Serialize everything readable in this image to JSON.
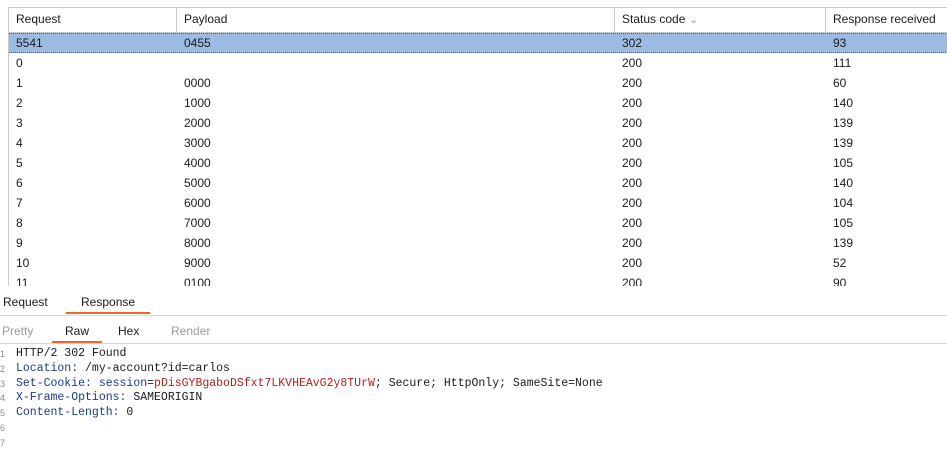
{
  "results_table": {
    "columns": [
      "Request",
      "Payload",
      "Status code",
      "Response received"
    ],
    "sorted_column_icon": "chevron-down-icon",
    "rows": [
      {
        "request": "5541",
        "payload": "0455",
        "status": "302",
        "response": "93",
        "selected": true
      },
      {
        "request": "0",
        "payload": "",
        "status": "200",
        "response": "111"
      },
      {
        "request": "1",
        "payload": "0000",
        "status": "200",
        "response": "60"
      },
      {
        "request": "2",
        "payload": "1000",
        "status": "200",
        "response": "140"
      },
      {
        "request": "3",
        "payload": "2000",
        "status": "200",
        "response": "139"
      },
      {
        "request": "4",
        "payload": "3000",
        "status": "200",
        "response": "139"
      },
      {
        "request": "5",
        "payload": "4000",
        "status": "200",
        "response": "105"
      },
      {
        "request": "6",
        "payload": "5000",
        "status": "200",
        "response": "140"
      },
      {
        "request": "7",
        "payload": "6000",
        "status": "200",
        "response": "104"
      },
      {
        "request": "8",
        "payload": "7000",
        "status": "200",
        "response": "105"
      },
      {
        "request": "9",
        "payload": "8000",
        "status": "200",
        "response": "139"
      },
      {
        "request": "10",
        "payload": "9000",
        "status": "200",
        "response": "52"
      },
      {
        "request": "11",
        "payload": "0100",
        "status": "200",
        "response": "90"
      }
    ]
  },
  "tabs": {
    "request": "Request",
    "response": "Response",
    "active": "Response"
  },
  "subtabs": {
    "pretty": "Pretty",
    "raw": "Raw",
    "hex": "Hex",
    "render": "Render",
    "active": "Raw"
  },
  "response_lines": [
    {
      "n": "1",
      "parts": [
        {
          "t": "HTTP/2 302 Found",
          "c": ""
        }
      ]
    },
    {
      "n": "2",
      "parts": [
        {
          "t": "Location:",
          "c": "hname"
        },
        {
          "t": " /my-account?id=carlos",
          "c": ""
        }
      ]
    },
    {
      "n": "3",
      "parts": [
        {
          "t": "Set-Cookie:",
          "c": "hname"
        },
        {
          "t": " ",
          "c": ""
        },
        {
          "t": "session",
          "c": "hname"
        },
        {
          "t": "=",
          "c": ""
        },
        {
          "t": "pDisGYBgaboDSfxt7LKVHEAvG2y8TUrW",
          "c": "hval-red"
        },
        {
          "t": "; Secure; HttpOnly; SameSite=None",
          "c": ""
        }
      ]
    },
    {
      "n": "4",
      "parts": [
        {
          "t": "X-Frame-Options:",
          "c": "hname"
        },
        {
          "t": " SAMEORIGIN",
          "c": ""
        }
      ]
    },
    {
      "n": "5",
      "parts": [
        {
          "t": "Content-Length:",
          "c": "hname"
        },
        {
          "t": " 0",
          "c": ""
        }
      ]
    },
    {
      "n": "6",
      "parts": []
    },
    {
      "n": "7",
      "parts": []
    }
  ],
  "colors": {
    "accent": "#f0662a",
    "selection": "#9bbbe3",
    "header_name": "#1a3a8f",
    "cookie_value": "#b02020"
  }
}
